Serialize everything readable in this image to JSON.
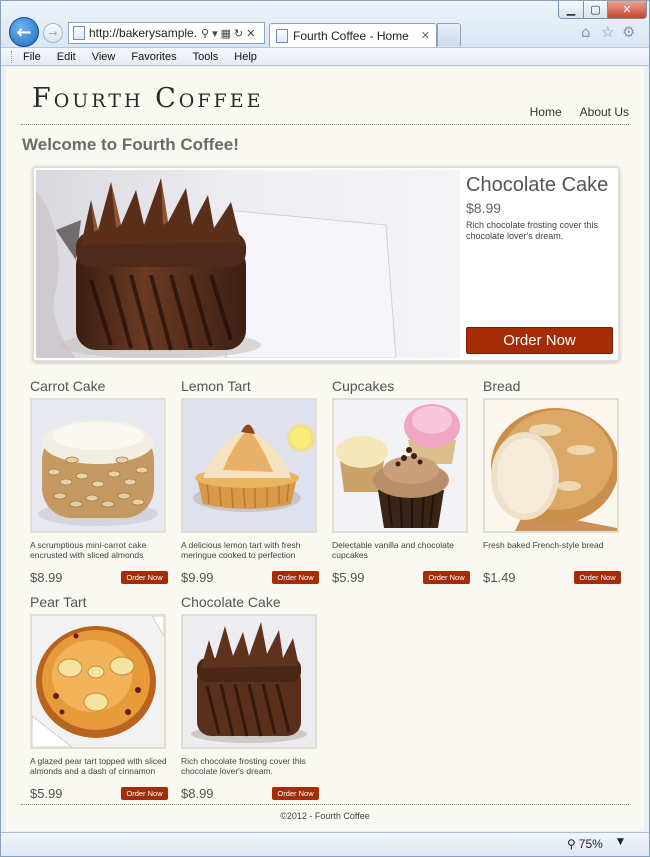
{
  "browser": {
    "url": "http://bakerysample....",
    "tab_title": "Fourth Coffee - Home",
    "minimize_glyph": "▁",
    "maximize_glyph": "▢",
    "close_glyph": "✕",
    "menu": [
      "File",
      "Edit",
      "View",
      "Favorites",
      "Tools",
      "Help"
    ],
    "zoom": "75%"
  },
  "site": {
    "logo": "Fourth Coffee",
    "nav": [
      "Home",
      "About Us"
    ],
    "welcome": "Welcome to Fourth Coffee!",
    "footer": "©2012 - Fourth Coffee",
    "accent_color": "#a42d08"
  },
  "featured": {
    "name": "Chocolate Cake",
    "price": "$8.99",
    "description": "Rich chocolate frosting cover this chocolate lover's dream.",
    "order_label": "Order Now"
  },
  "products": [
    {
      "name": "Carrot Cake",
      "description": "A scrumptious mini-carrot cake encrusted with sliced almonds",
      "price": "$8.99",
      "order_label": "Order Now"
    },
    {
      "name": "Lemon Tart",
      "description": "A delicious lemon tart with fresh meringue cooked to perfection",
      "price": "$9.99",
      "order_label": "Order Now"
    },
    {
      "name": "Cupcakes",
      "description": "Delectable vanilla and chocolate cupcakes",
      "price": "$5.99",
      "order_label": "Order Now"
    },
    {
      "name": "Bread",
      "description": "Fresh baked French-style bread",
      "price": "$1.49",
      "order_label": "Order Now"
    },
    {
      "name": "Pear Tart",
      "description": "A glazed pear tart topped with sliced almonds and a dash of cinnamon",
      "price": "$5.99",
      "order_label": "Order Now"
    },
    {
      "name": "Chocolate Cake",
      "description": "Rich chocolate frosting cover this chocolate lover's dream.",
      "price": "$8.99",
      "order_label": "Order Now"
    }
  ]
}
